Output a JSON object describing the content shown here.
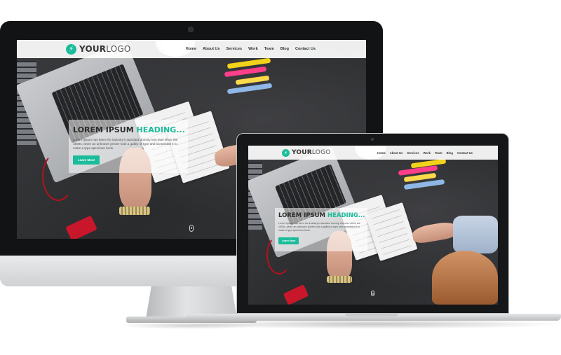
{
  "site": {
    "logo": {
      "icon": "lightning-bolt-icon",
      "bold_text": "YOUR",
      "light_text": "LOGO"
    },
    "nav": [
      "Home",
      "About Us",
      "Services",
      "Work",
      "Team",
      "Blog",
      "Contact Us"
    ],
    "hero": {
      "heading_dark": "LOREM IPSUM",
      "heading_accent": "HEADING...",
      "body": "Lorem Ipsum has been the industry's standard dummy text ever since the 1500s, when an unknown printer took a galley of type and scrambled it to make a type specimen book.",
      "button_label": "Learn More"
    },
    "scroll_icon": "mouse-scroll-icon"
  },
  "colors": {
    "accent": "#1bbc9b",
    "nav_background": "#ffffff",
    "device_bezel": "#121314"
  }
}
